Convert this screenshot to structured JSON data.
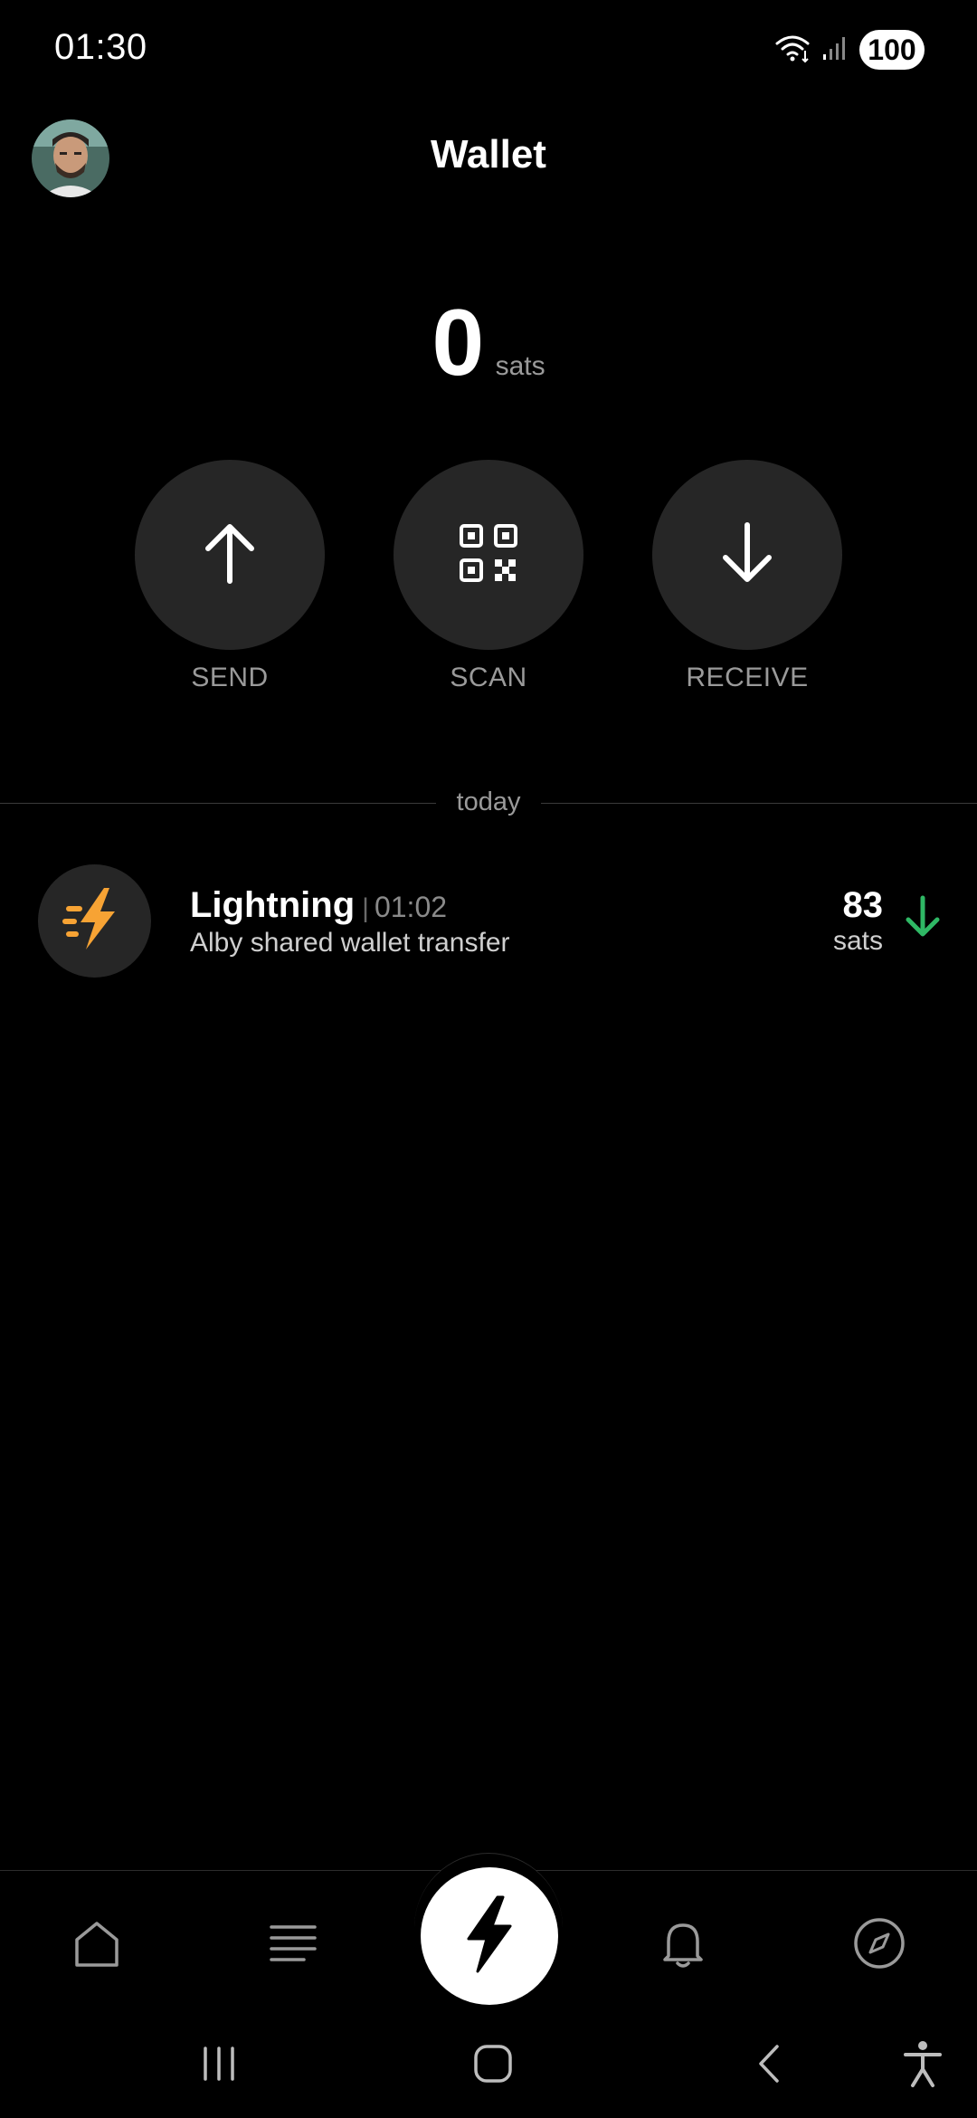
{
  "status_bar": {
    "time": "01:30",
    "battery": "100",
    "icons": [
      "wifi-icon",
      "signal-icon",
      "battery-icon"
    ]
  },
  "header": {
    "title": "Wallet",
    "avatar_icon": "avatar"
  },
  "balance": {
    "value": "0",
    "unit": "sats"
  },
  "actions": [
    {
      "label": "SEND",
      "icon": "arrow-up-icon"
    },
    {
      "label": "SCAN",
      "icon": "qr-code-icon"
    },
    {
      "label": "RECEIVE",
      "icon": "arrow-down-icon"
    }
  ],
  "transactions": {
    "group_label": "today",
    "items": [
      {
        "type": "Lightning",
        "separator": "|",
        "time": "01:02",
        "description": "Alby shared wallet transfer",
        "amount": "83",
        "unit": "sats",
        "direction": "incoming",
        "direction_color": "#2fb865",
        "icon_color": "#f7a334"
      }
    ]
  },
  "bottom_nav": {
    "items": [
      "home-icon",
      "list-icon",
      "lightning-icon",
      "bell-icon",
      "compass-icon"
    ],
    "active": "lightning-icon"
  },
  "system_nav": [
    "recent-apps-icon",
    "home-icon",
    "back-icon",
    "accessibility-icon"
  ],
  "colors": {
    "background": "#000000",
    "surface": "#262626",
    "muted_text": "#9a9a9a",
    "accent_orange": "#f7a334",
    "incoming_green": "#2fb865"
  }
}
